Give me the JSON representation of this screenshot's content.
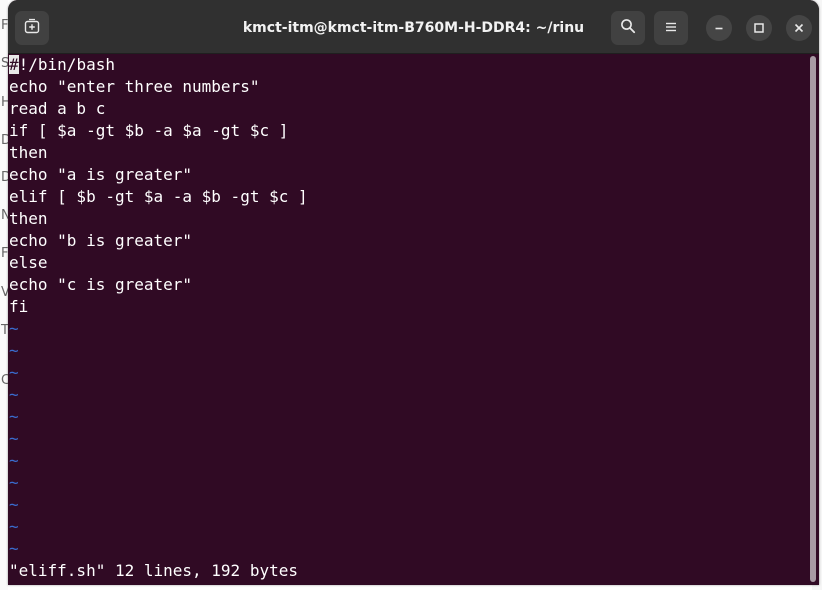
{
  "window": {
    "title": "kmct-itm@kmct-itm-B760M-H-DDR4: ~/rinu"
  },
  "background_letters": [
    "F",
    "S",
    "H",
    "D",
    "D",
    "N",
    "F",
    "V",
    "T",
    "C"
  ],
  "editor": {
    "first_char": "#",
    "first_rest": "!/bin/bash",
    "lines": [
      "echo \"enter three numbers\"",
      "read a b c",
      "if [ $a -gt $b -a $a -gt $c ]",
      "then",
      "echo \"a is greater\"",
      "elif [ $b -gt $a -a $b -gt $c ]",
      "then",
      "echo \"b is greater\"",
      "else",
      "echo \"c is greater\"",
      "fi"
    ],
    "tilde": "~",
    "status": "\"eliff.sh\" 12 lines, 192 bytes"
  },
  "icons": {
    "new_tab": "new-tab-icon",
    "search": "search-icon",
    "menu": "hamburger-menu-icon",
    "minimize": "minimize-icon",
    "maximize": "maximize-icon",
    "close": "close-icon"
  },
  "colors": {
    "terminal_bg": "#300a24",
    "titlebar_bg": "#303030",
    "text": "#ffffff",
    "tilde": "#3a6dd0"
  }
}
